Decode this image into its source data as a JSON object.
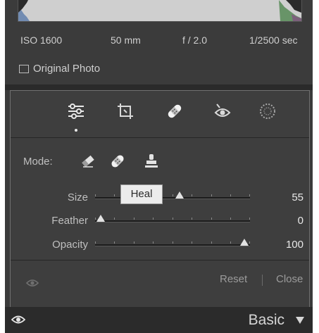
{
  "exif": {
    "iso": "ISO 1600",
    "focal": "50 mm",
    "aperture": "f / 2.0",
    "shutter": "1/2500 sec"
  },
  "original_photo_label": "Original Photo",
  "original_photo_checked": false,
  "tools": [
    {
      "icon": "edit-sliders-icon",
      "active": true
    },
    {
      "icon": "crop-icon",
      "active": false
    },
    {
      "icon": "healing-bandage-icon",
      "active": false
    },
    {
      "icon": "red-eye-icon",
      "active": false
    },
    {
      "icon": "radial-mask-icon",
      "active": false
    }
  ],
  "mode": {
    "label": "Mode:",
    "options": [
      "eraser-icon",
      "heal-bandage-icon",
      "clone-stamp-icon"
    ]
  },
  "tooltip": "Heal",
  "sliders": {
    "size": {
      "label": "Size",
      "value": "55",
      "fraction": 0.55
    },
    "feather": {
      "label": "Feather",
      "value": "0",
      "fraction": 0.0
    },
    "opacity": {
      "label": "Opacity",
      "value": "100",
      "fraction": 1.0
    }
  },
  "footer": {
    "reset": "Reset",
    "close": "Close"
  },
  "panel_header": {
    "title": "Basic"
  },
  "colors": {
    "panel_bg": "#3e3e3e",
    "bar_bg": "#2b2b2b",
    "text": "#c9c9c9"
  }
}
